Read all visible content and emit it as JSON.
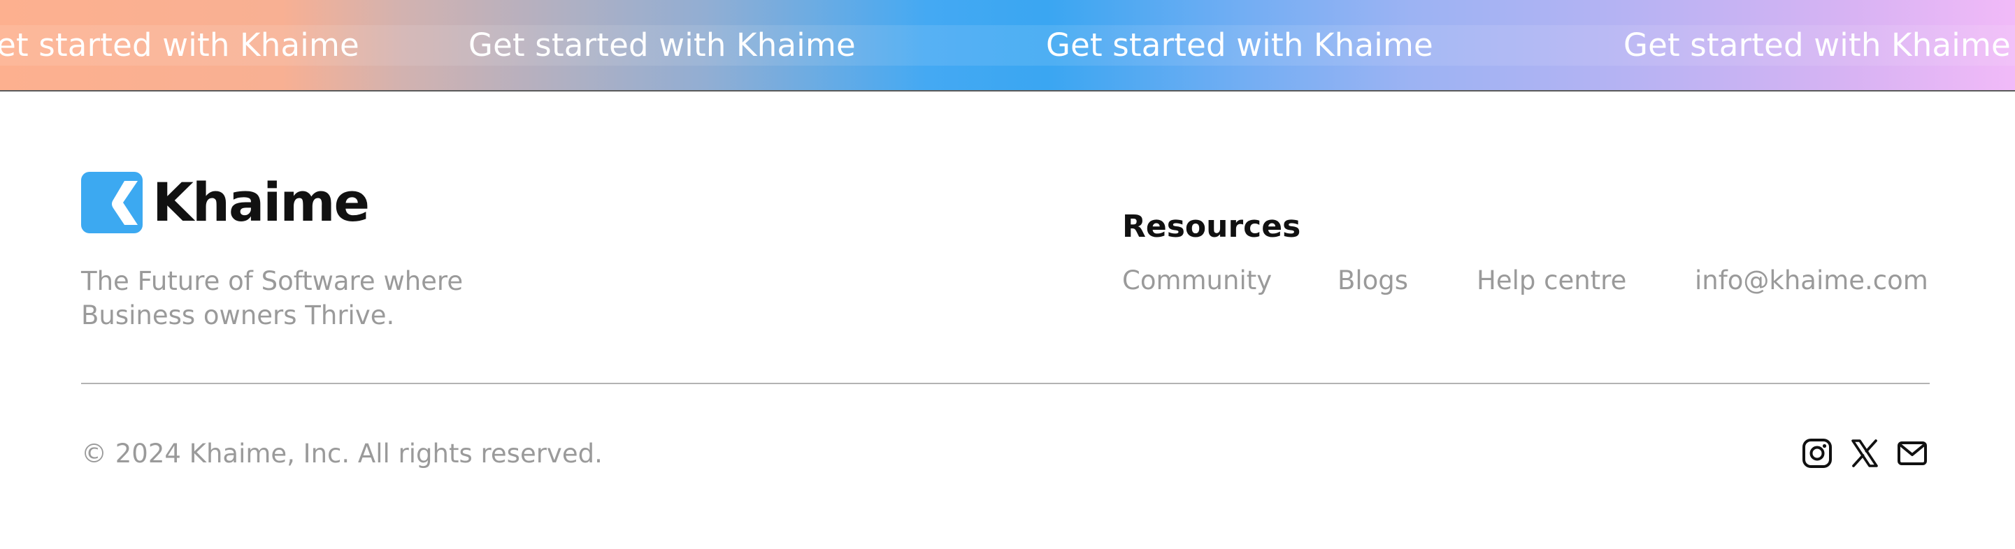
{
  "banner": {
    "items": [
      "Get started with Khaime",
      "Get started with Khaime",
      "Get started with Khaime",
      "Get started with Khaime"
    ],
    "gradient_colors": [
      "#fdb08f",
      "#3aa6f2",
      "#9cb3f3",
      "#f1baf8"
    ],
    "text_color": "#ffffff"
  },
  "footer": {
    "brand": {
      "name": "Khaime",
      "logo_icon": "khaime-k-logo-icon",
      "logo_color": "#3ca9f1",
      "tagline": "The Future of Software where Business owners Thrive."
    },
    "resources": {
      "heading": "Resources",
      "links": [
        "Community",
        "Blogs",
        "Help centre",
        "info@khaime.com"
      ]
    },
    "copyright": "© 2024 Khaime, Inc. All rights reserved.",
    "social": [
      {
        "icon": "instagram-icon"
      },
      {
        "icon": "x-twitter-icon"
      },
      {
        "icon": "mail-icon"
      }
    ]
  }
}
